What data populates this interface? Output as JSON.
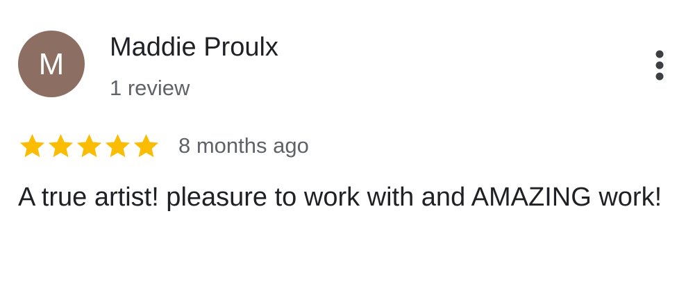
{
  "review": {
    "avatar_letter": "M",
    "avatar_color": "#8d6e63",
    "reviewer_name": "Maddie Proulx",
    "review_count": "1 review",
    "rating": 5,
    "rating_max": 5,
    "star_color": "#fbbc04",
    "date": "8 months ago",
    "text": "A true artist! pleasure to work with and AMAZING work!"
  },
  "icons": {
    "more": "more-vert-icon",
    "star": "star-icon"
  }
}
